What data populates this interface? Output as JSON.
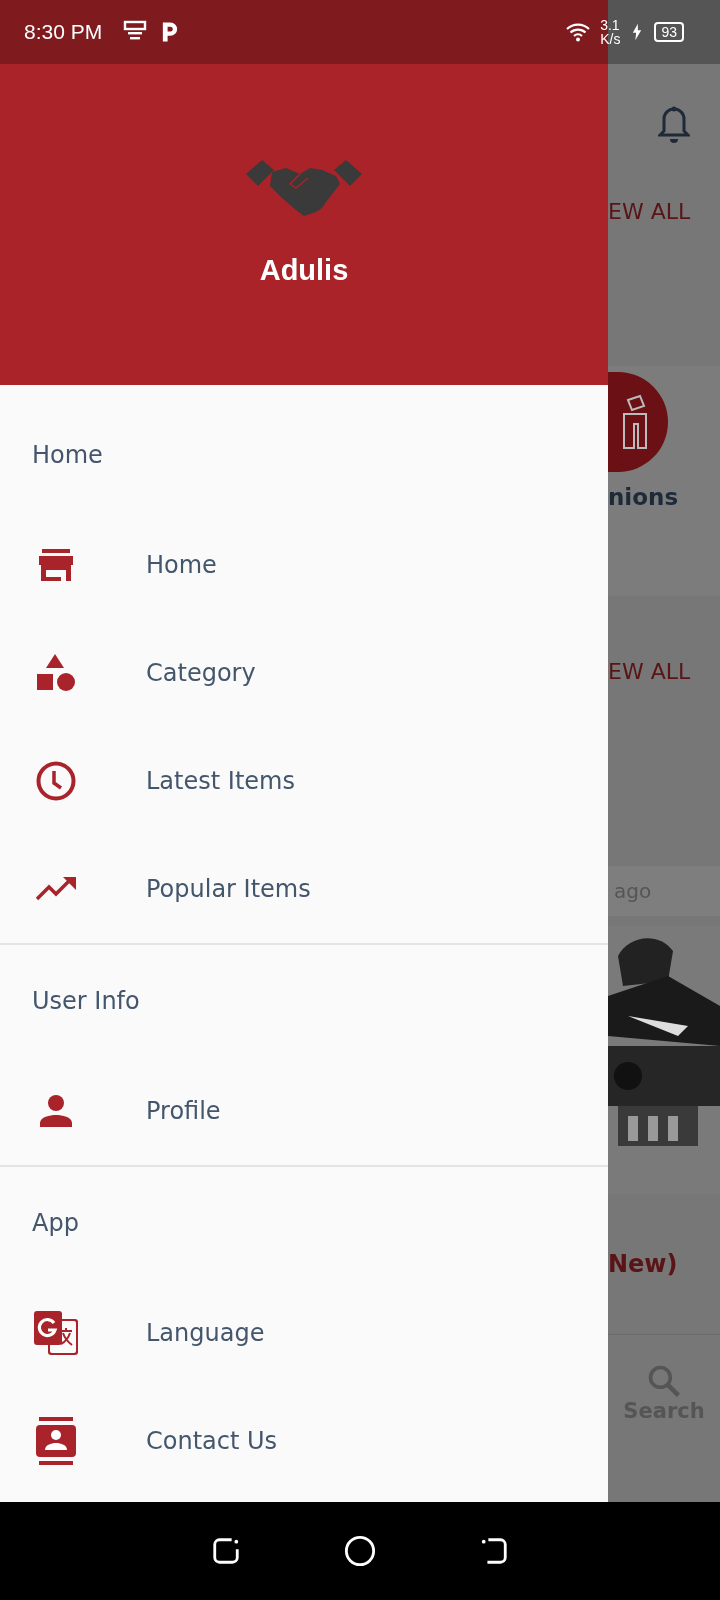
{
  "status_bar": {
    "time": "8:30 PM",
    "network_speed": [
      "3.1",
      "K/s"
    ],
    "battery": "93"
  },
  "drawer": {
    "app_name": "Adulis",
    "sections": [
      {
        "title": "Home",
        "items": [
          {
            "label": "Home"
          },
          {
            "label": "Category"
          },
          {
            "label": "Latest Items"
          },
          {
            "label": "Popular Items"
          }
        ]
      },
      {
        "title": "User Info",
        "items": [
          {
            "label": "Profile"
          }
        ]
      },
      {
        "title": "App",
        "items": [
          {
            "label": "Language"
          },
          {
            "label": "Contact Us"
          }
        ]
      }
    ]
  },
  "background": {
    "view_all_1": "EW ALL",
    "category_label": "nions",
    "view_all_2": "EW ALL",
    "time_ago": "ago",
    "section_title": "New)",
    "search_tab": "Search"
  }
}
